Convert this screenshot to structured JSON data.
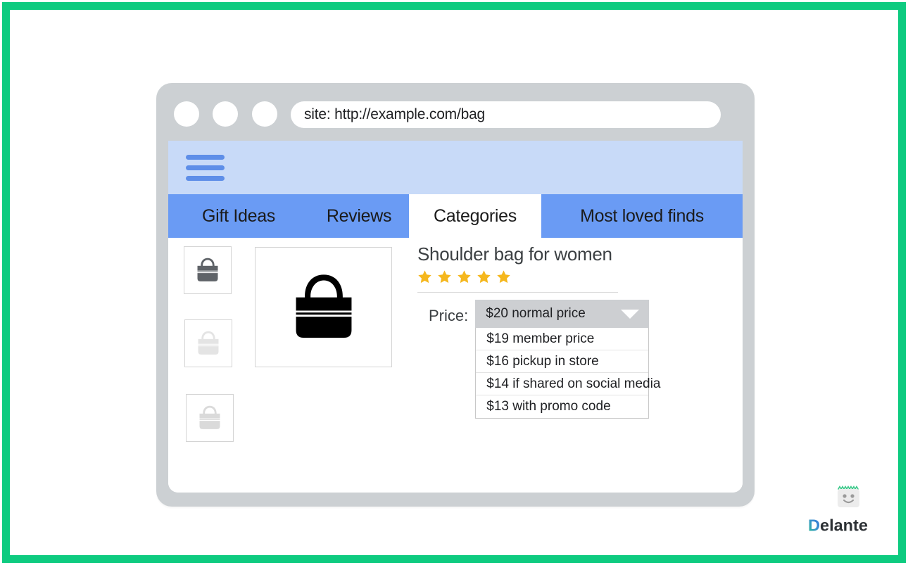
{
  "frame": {
    "border_color": "#0ecb80"
  },
  "browser": {
    "dots": [
      "window-dot-1",
      "window-dot-2",
      "window-dot-3"
    ],
    "url": "site: http://example.com/bag"
  },
  "site": {
    "menu_icon": "hamburger-icon",
    "tabs": [
      {
        "label": "Gift Ideas",
        "active": false
      },
      {
        "label": "Reviews",
        "active": false
      },
      {
        "label": "Categories",
        "active": true
      },
      {
        "label": "Most loved finds",
        "active": false
      }
    ],
    "tab_colors": {
      "inactive_bg": "#6a9bf4",
      "active_bg": "#ffffff",
      "header_bg": "#c8daf8"
    }
  },
  "product": {
    "title": "Shoulder bag for women",
    "rating": 5,
    "rating_max": 5,
    "star_color": "#f5b71d",
    "thumbnails": [
      {
        "name": "thumbnail-1",
        "tone": "#5f6368"
      },
      {
        "name": "thumbnail-2",
        "tone": "#e8e8e8"
      },
      {
        "name": "thumbnail-3",
        "tone": "#dcdcdc"
      }
    ],
    "main_image_alt": "shoulder-bag"
  },
  "price": {
    "label": "Price:",
    "selected": "$20 normal price",
    "options": [
      "$19 member price",
      "$16 pickup in store",
      "$14 if shared on social media",
      "$13 with promo code"
    ]
  },
  "logo": {
    "word": "Delante",
    "mark": "smiley-calendar-icon"
  }
}
